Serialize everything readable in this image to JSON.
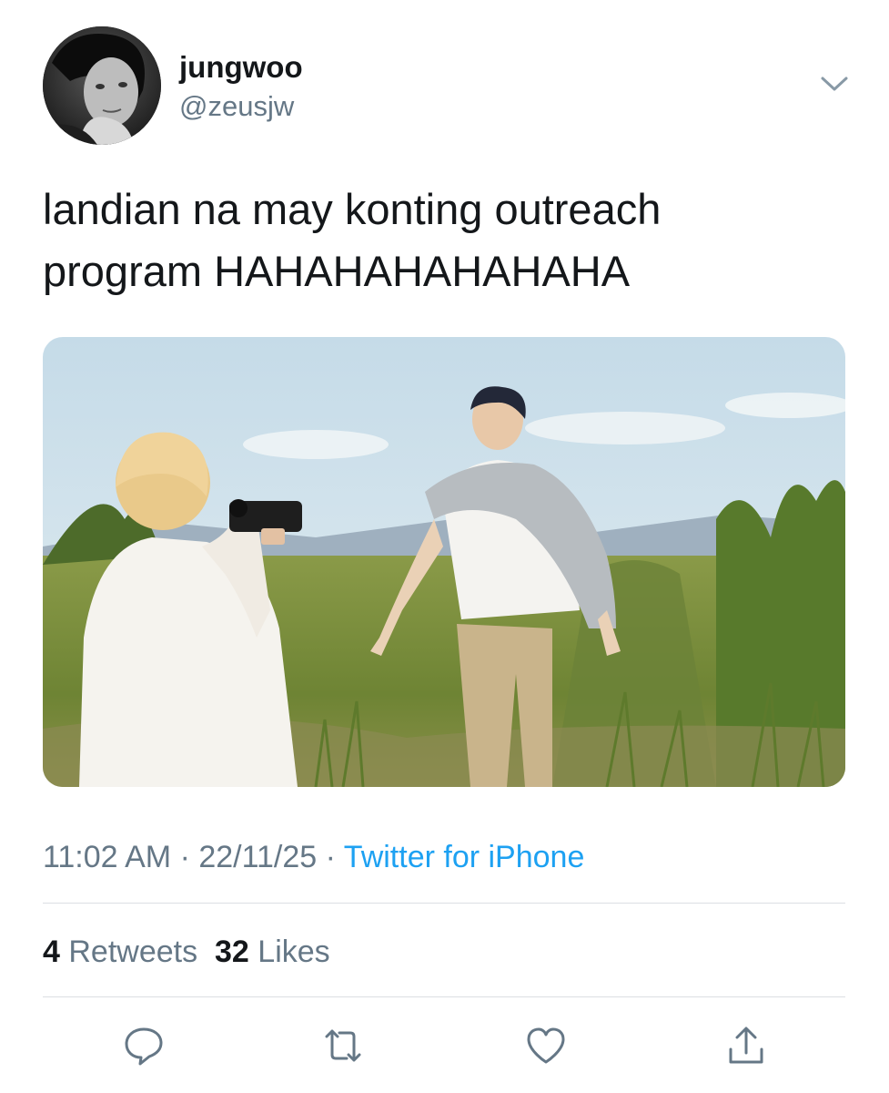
{
  "user": {
    "display_name": "jungwoo",
    "handle": "@zeusjw"
  },
  "tweet": {
    "text_lines": [
      "landian na may konting outreach",
      "program HAHAHAHAHAHAHA"
    ],
    "time": "11:02 AM",
    "date": "22/11/25",
    "separator": " · ",
    "source": "Twitter for iPhone"
  },
  "stats": {
    "retweets_count": "4",
    "retweets_label": "Retweets",
    "likes_count": "32",
    "likes_label": "Likes"
  },
  "icons": {
    "menu": "chevron-down-icon",
    "reply": "reply-icon",
    "retweet": "retweet-icon",
    "like": "heart-icon",
    "share": "share-icon"
  },
  "colors": {
    "link": "#1da1f2",
    "secondary_text": "#657786",
    "icon": "#657786"
  }
}
